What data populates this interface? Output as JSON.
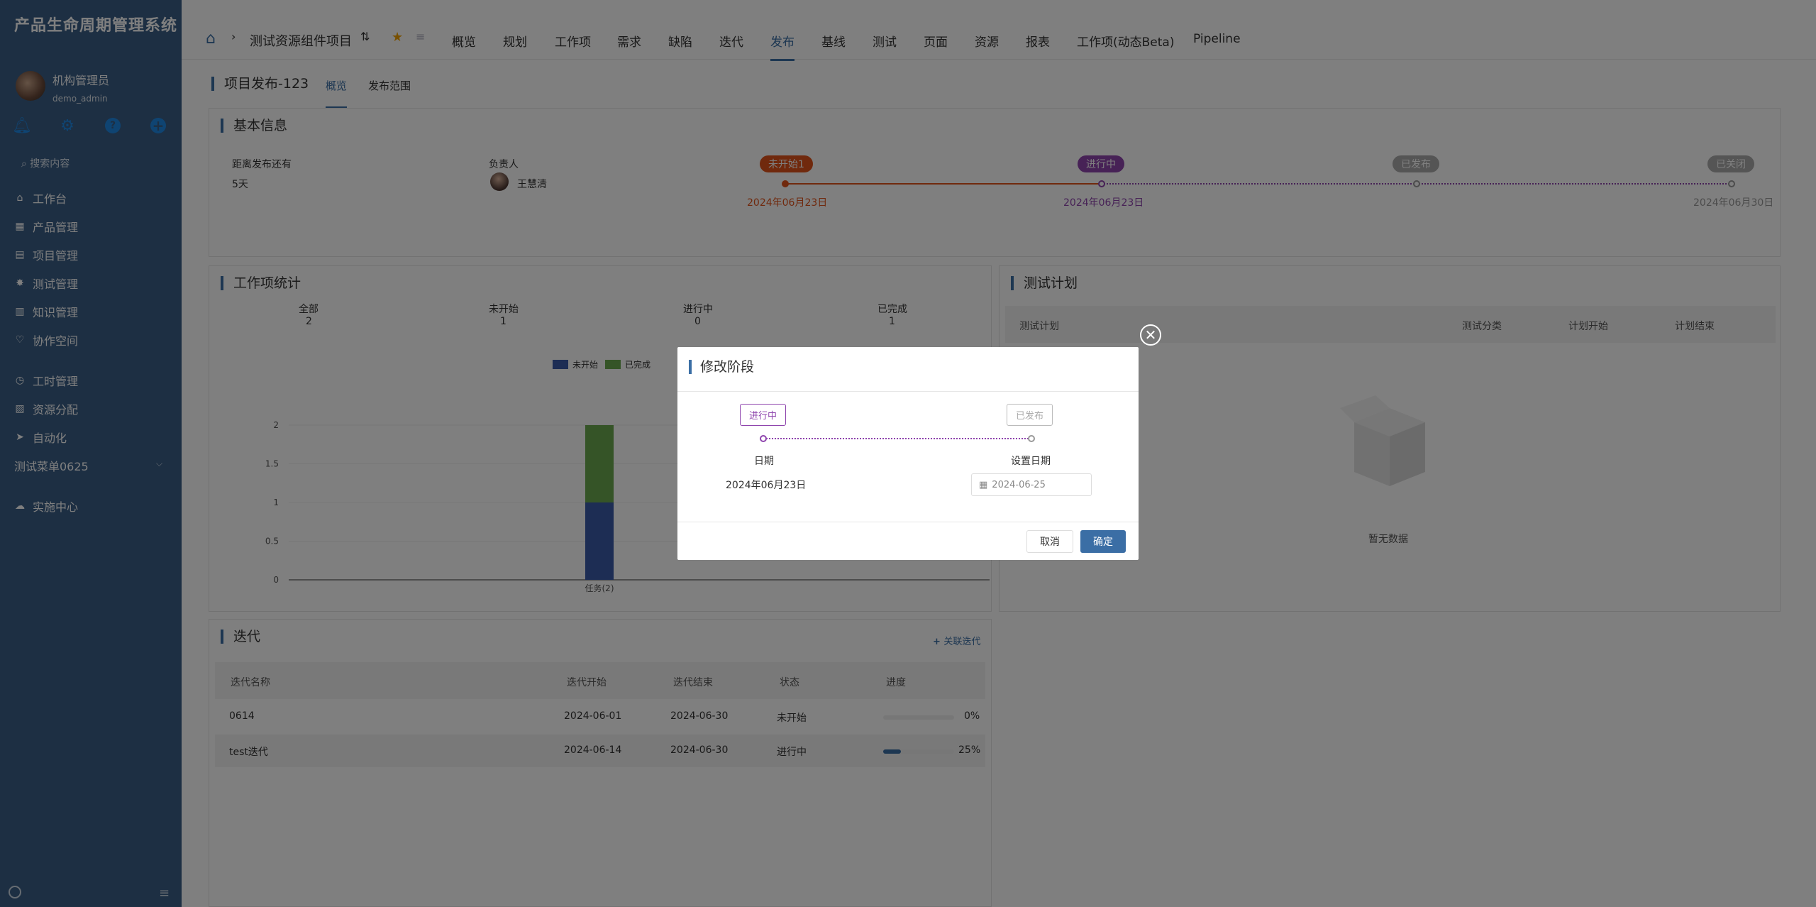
{
  "app": {
    "title": "产品生命周期管理系统"
  },
  "user": {
    "name": "机构管理员",
    "id": "demo_admin"
  },
  "sidebar": {
    "search": "搜索内容",
    "items": [
      {
        "label": "工作台",
        "icon": "home-icon"
      },
      {
        "label": "产品管理",
        "icon": "grid-icon"
      },
      {
        "label": "项目管理",
        "icon": "file-icon"
      },
      {
        "label": "测试管理",
        "icon": "bug-icon"
      },
      {
        "label": "知识管理",
        "icon": "book-icon"
      },
      {
        "label": "协作空间",
        "icon": "handshake-icon"
      },
      {
        "label": "工时管理",
        "icon": "clock-icon"
      },
      {
        "label": "资源分配",
        "icon": "resource-icon"
      },
      {
        "label": "自动化",
        "icon": "rocket-icon"
      },
      {
        "label": "测试菜单0625",
        "icon": ""
      },
      {
        "label": "实施中心",
        "icon": "cloud-icon"
      }
    ]
  },
  "header": {
    "project": "测试资源组件项目",
    "tabs": [
      "概览",
      "规划",
      "工作项",
      "需求",
      "缺陷",
      "迭代",
      "发布",
      "基线",
      "测试",
      "页面",
      "资源",
      "报表",
      "工作项(动态Beta)",
      "Pipeline"
    ],
    "active_tab": "发布"
  },
  "subheader": {
    "title": "项目发布-123",
    "tabs": [
      "概览",
      "发布范围"
    ]
  },
  "basic": {
    "title": "基本信息",
    "remain_label": "距离发布还有",
    "remain_value": "5天",
    "owner_label": "负责人",
    "owner_name": "王慧清",
    "stages": [
      {
        "label": "未开始1",
        "date": "2024年06月23日",
        "color": "#e0531b"
      },
      {
        "label": "进行中",
        "date": "2024年06月23日",
        "color": "#8e44ad"
      },
      {
        "label": "已发布",
        "date": "",
        "color": "#aaaaaa"
      },
      {
        "label": "已关闭",
        "date": "2024年06月30日",
        "color": "#aaaaaa"
      }
    ]
  },
  "stats": {
    "title": "工作项统计",
    "cols": [
      {
        "label": "全部",
        "value": "2"
      },
      {
        "label": "未开始",
        "value": "1"
      },
      {
        "label": "进行中",
        "value": "0"
      },
      {
        "label": "已完成",
        "value": "1"
      }
    ],
    "legend": [
      "未开始",
      "已完成"
    ]
  },
  "chart_data": {
    "type": "bar",
    "categories": [
      "任务(2)"
    ],
    "series": [
      {
        "name": "未开始",
        "values": [
          1
        ]
      },
      {
        "name": "已完成",
        "values": [
          1
        ]
      }
    ],
    "ylim": [
      0,
      2
    ],
    "yticks": [
      "0",
      "0.5",
      "1",
      "1.5",
      "2"
    ],
    "stacked": true,
    "colors": {
      "未开始": "#3b5aa8",
      "已完成": "#6aa84f"
    }
  },
  "testplan": {
    "title": "测试计划",
    "headers": [
      "测试计划",
      "测试分类",
      "计划开始",
      "计划结束"
    ],
    "empty": "暂无数据"
  },
  "iteration": {
    "title": "迭代",
    "link": "关联迭代",
    "headers": [
      "迭代名称",
      "迭代开始",
      "迭代结束",
      "状态",
      "进度"
    ],
    "rows": [
      {
        "name": "0614",
        "start": "2024-06-01",
        "end": "2024-06-30",
        "status": "未开始",
        "progress": "0%",
        "pct": 0
      },
      {
        "name": "test迭代",
        "start": "2024-06-14",
        "end": "2024-06-30",
        "status": "进行中",
        "progress": "25%",
        "pct": 25
      }
    ]
  },
  "modal": {
    "title": "修改阶段",
    "from": "进行中",
    "to": "已发布",
    "date_label": "日期",
    "date_value": "2024年06月23日",
    "set_label": "设置日期",
    "set_value": "2024-06-25",
    "cancel": "取消",
    "confirm": "确定"
  }
}
